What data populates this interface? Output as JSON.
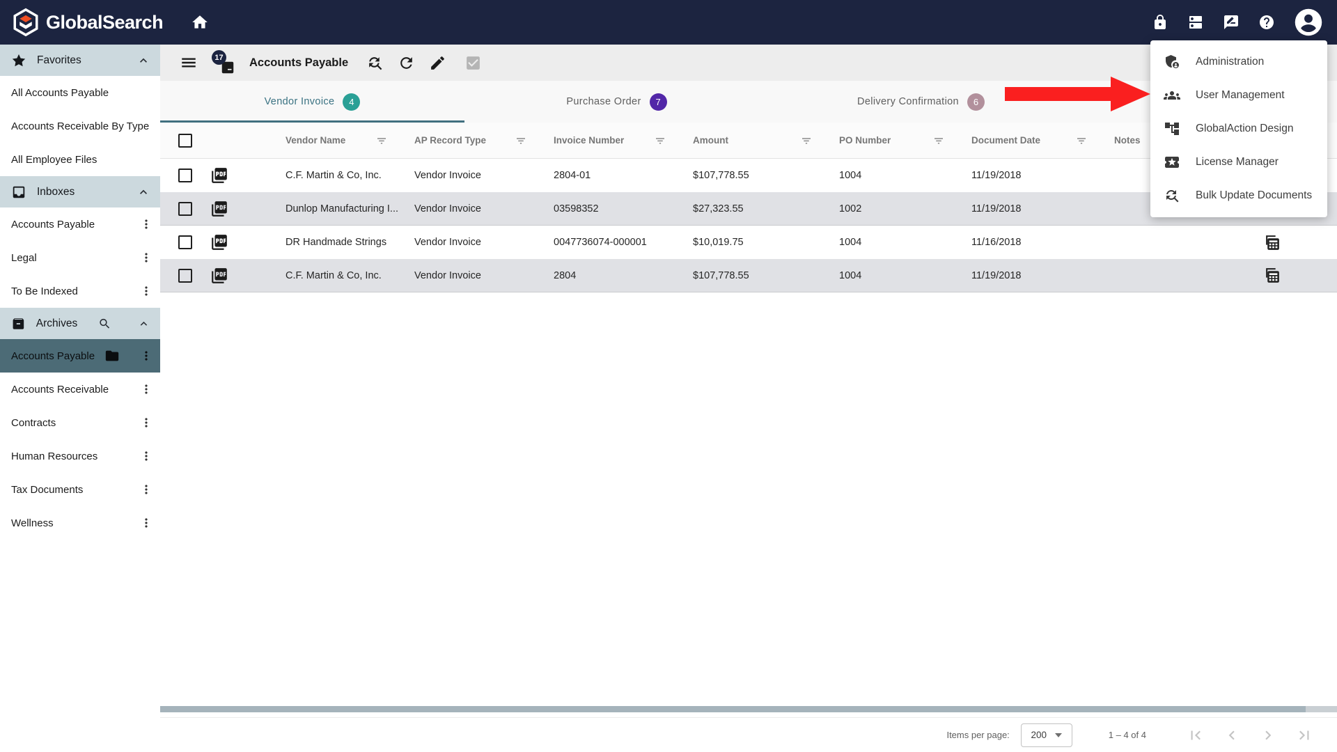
{
  "header": {
    "brand": "GlobalSearch"
  },
  "colors": {
    "topbar_bg": "#1c2440",
    "logo_orange": "#f04e23",
    "section_header_bg": "#ccd9de",
    "selected_item_bg": "#4c6b76",
    "tab_active": "#3a7282",
    "badge_teal": "#2aa096",
    "badge_purple": "#5227a8",
    "badge_mauve": "#b2909c",
    "row_alt_bg": "#e0e1e5",
    "arrow_red": "#fa1f1f",
    "doc_badge_bg": "#1c2440"
  },
  "icons": {
    "topbar": [
      "home-icon",
      "lock-icon",
      "storage-icon",
      "feedback-icon",
      "help-icon",
      "avatar"
    ],
    "sidebar": [
      "star-icon",
      "inbox-icon",
      "archive-icon",
      "search-icon",
      "chevron-up-icon",
      "kebab-icon",
      "folder-icon"
    ],
    "toolbar": [
      "hamburger-icon",
      "document-count-icon",
      "find-replace-icon",
      "refresh-icon",
      "edit-icon",
      "approve-icon"
    ],
    "table": [
      "checkbox",
      "pdf-icon",
      "filter-icon",
      "notes-icon"
    ],
    "menu": [
      "admin-shield-icon",
      "groups-icon",
      "workflow-icon",
      "license-ticket-icon",
      "bulk-sync-icon"
    ],
    "pagination": [
      "first-page-icon",
      "prev-page-icon",
      "next-page-icon",
      "last-page-icon",
      "dropdown-caret"
    ]
  },
  "sidebar": {
    "sections": [
      {
        "label": "Favorites",
        "items": [
          "All Accounts Payable",
          "Accounts Receivable By Type",
          "All Employee Files"
        ]
      },
      {
        "label": "Inboxes",
        "items": [
          "Accounts Payable",
          "Legal",
          "To Be Indexed"
        ]
      },
      {
        "label": "Archives",
        "items": [
          "Accounts Payable",
          "Accounts Receivable",
          "Contracts",
          "Human Resources",
          "Tax Documents",
          "Wellness"
        ]
      }
    ]
  },
  "toolbar": {
    "title": "Accounts Payable",
    "doc_count_badge": "17"
  },
  "tabs": [
    {
      "label": "Vendor Invoice",
      "count": "4"
    },
    {
      "label": "Purchase Order",
      "count": "7"
    },
    {
      "label": "Delivery Confirmation",
      "count": "6"
    }
  ],
  "table": {
    "columns": [
      "Vendor Name",
      "AP Record Type",
      "Invoice Number",
      "Amount",
      "PO Number",
      "Document Date",
      "Notes"
    ],
    "rows": [
      {
        "vendor": "C.F. Martin & Co, Inc.",
        "type": "Vendor Invoice",
        "invoice": "2804-01",
        "amount": "$107,778.55",
        "po": "1004",
        "date": "11/19/2018"
      },
      {
        "vendor": "Dunlop Manufacturing I...",
        "type": "Vendor Invoice",
        "invoice": "03598352",
        "amount": "$27,323.55",
        "po": "1002",
        "date": "11/19/2018"
      },
      {
        "vendor": "DR Handmade Strings",
        "type": "Vendor Invoice",
        "invoice": "0047736074-000001",
        "amount": "$10,019.75",
        "po": "1004",
        "date": "11/16/2018"
      },
      {
        "vendor": "C.F. Martin & Co, Inc.",
        "type": "Vendor Invoice",
        "invoice": "2804",
        "amount": "$107,778.55",
        "po": "1004",
        "date": "11/19/2018"
      }
    ]
  },
  "menu": {
    "items": [
      "Administration",
      "User Management",
      "GlobalAction Design",
      "License Manager",
      "Bulk Update Documents"
    ]
  },
  "pagination": {
    "items_per_page_label": "Items per page:",
    "page_size": "200",
    "range_label": "1 – 4 of 4"
  }
}
